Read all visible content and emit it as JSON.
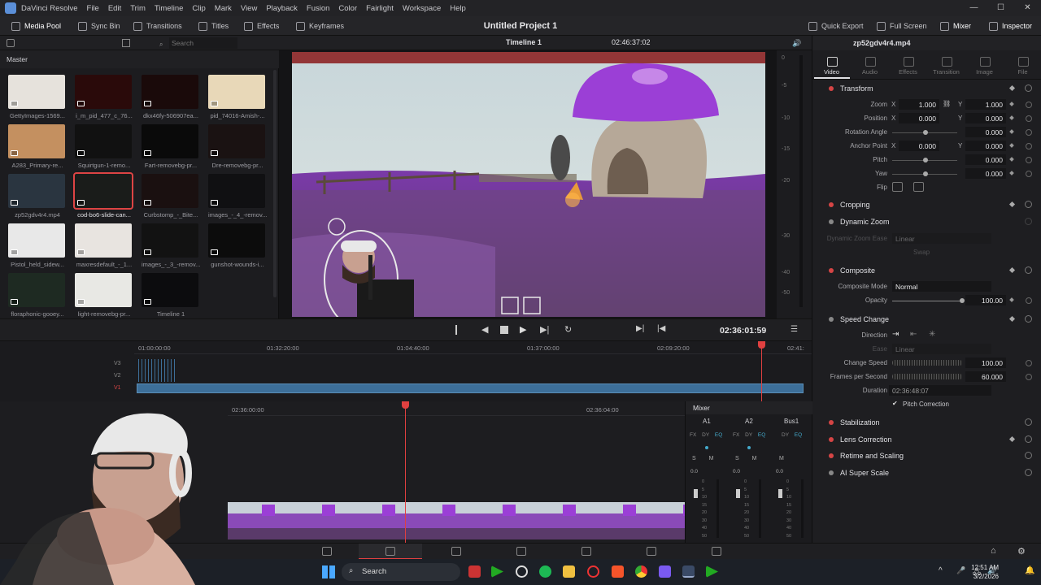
{
  "menubar": {
    "app_name": "DaVinci Resolve",
    "items": [
      "File",
      "Edit",
      "Trim",
      "Timeline",
      "Clip",
      "Mark",
      "View",
      "Playback",
      "Fusion",
      "Color",
      "Fairlight",
      "Workspace",
      "Help"
    ]
  },
  "toolbar": {
    "media_pool": "Media Pool",
    "sync_bin": "Sync Bin",
    "transitions": "Transitions",
    "titles": "Titles",
    "effects": "Effects",
    "keyframes": "Keyframes",
    "project_title": "Untitled Project 1",
    "quick_export": "Quick Export",
    "full_screen": "Full Screen",
    "mixer": "Mixer",
    "inspector": "Inspector"
  },
  "subbar": {
    "search_placeholder": "Search",
    "timeline_name": "Timeline 1",
    "timecode": "02:46:37:02"
  },
  "media_pool": {
    "bin": "Master",
    "clips": [
      {
        "name": "GettyImages-1569...",
        "color": "#e6e2dc"
      },
      {
        "name": "i_m_pid_477_c_76...",
        "color": "#2a0a0a"
      },
      {
        "name": "dkx46fy-506907ea...",
        "color": "#1a0a0a"
      },
      {
        "name": "pid_74016-Amish-...",
        "color": "#e8d8b8"
      },
      {
        "name": "A283_Primary-re...",
        "color": "#c49060"
      },
      {
        "name": "Squirtgun-1-remo...",
        "color": "#111111"
      },
      {
        "name": "Fart-removebg-pr...",
        "color": "#0a0a0a"
      },
      {
        "name": "Dre-removebg-pr...",
        "color": "#1a1212"
      },
      {
        "name": "zp52gdv4r4.mp4",
        "color": "#2a3540"
      },
      {
        "name": "cod-bo6-slide-can...",
        "color": "#1a1c1a"
      },
      {
        "name": "Curbstomp_-_Bite...",
        "color": "#1a1010"
      },
      {
        "name": "images_-_4_-remov...",
        "color": "#101012"
      },
      {
        "name": "Pistol_held_sidew...",
        "color": "#e8e8e8"
      },
      {
        "name": "maxresdefault_-_1...",
        "color": "#e8e4e0"
      },
      {
        "name": "images_-_3_-remov...",
        "color": "#121212"
      },
      {
        "name": "gunshot-wounds-i...",
        "color": "#0c0c0c"
      },
      {
        "name": "floraphonic-gooey...",
        "color": "#1e2a22"
      },
      {
        "name": "light-removebg-pr...",
        "color": "#e8e8e4"
      },
      {
        "name": "Timeline 1",
        "color": "#0c0c0e"
      }
    ]
  },
  "transport": {
    "timecode": "02:36:01:59"
  },
  "mini_timeline": {
    "ruler": [
      "01:00:00:00",
      "01:32:20:00",
      "01:04:40:00",
      "01:37:00:00",
      "02:09:20:00",
      "02:41:"
    ],
    "tracks": [
      "V3",
      "V2",
      "V1"
    ]
  },
  "edit_timeline": {
    "ruler": [
      "02:36:00:00",
      "02:36:04:00"
    ]
  },
  "mixer_panel": {
    "title": "Mixer",
    "channels": [
      "A1",
      "A2",
      "Bus1"
    ],
    "fx_labels": [
      "FX",
      "DY",
      "EQ"
    ],
    "sm": [
      "S",
      "M"
    ],
    "db": "0.0",
    "scale": [
      "0",
      "5",
      "10",
      "15",
      "20",
      "30",
      "40",
      "50"
    ]
  },
  "inspector": {
    "clip_name": "zp52gdv4r4.mp4",
    "tabs": [
      "Video",
      "Audio",
      "Effects",
      "Transition",
      "Image",
      "File"
    ],
    "transform": {
      "title": "Transform",
      "zoom_label": "Zoom",
      "zoom_x": "1.000",
      "zoom_y": "1.000",
      "position_label": "Position",
      "position_x": "0.000",
      "position_y": "0.000",
      "rotation_label": "Rotation Angle",
      "rotation": "0.000",
      "anchor_label": "Anchor Point",
      "anchor_x": "0.000",
      "anchor_y": "0.000",
      "pitch_label": "Pitch",
      "pitch": "0.000",
      "yaw_label": "Yaw",
      "yaw": "0.000",
      "flip_label": "Flip",
      "x": "X",
      "y": "Y"
    },
    "cropping": "Cropping",
    "dynamic_zoom": "Dynamic Zoom",
    "dynamic_zoom_ease": "Dynamic Zoom Ease",
    "dynamic_zoom_ease_val": "Linear",
    "swap": "Swap",
    "composite": {
      "title": "Composite",
      "mode_label": "Composite Mode",
      "mode": "Normal",
      "opacity_label": "Opacity",
      "opacity": "100.00"
    },
    "speed": {
      "title": "Speed Change",
      "direction_label": "Direction",
      "ease_label": "Ease",
      "ease": "Linear",
      "change_speed_label": "Change Speed",
      "change_speed": "100.00",
      "fps_label": "Frames per Second",
      "fps": "60.000",
      "duration_label": "Duration",
      "duration": "02:36:48:07",
      "pitch_correction": "Pitch Correction"
    },
    "stabilization": "Stabilization",
    "lens_correction": "Lens Correction",
    "retime": "Retime and Scaling",
    "super_scale": "AI Super Scale"
  },
  "meter_scale": [
    "0",
    "-5",
    "-10",
    "-15",
    "-20",
    "-30",
    "-40",
    "-50"
  ],
  "taskbar": {
    "search": "Search",
    "time": "12:51 AM",
    "date": "3/2/2026"
  },
  "colors": {
    "accent_red": "#d64545",
    "playhead": "#e04040",
    "clip_blue": "#3d6f99",
    "purple": "#9b3fd6"
  }
}
